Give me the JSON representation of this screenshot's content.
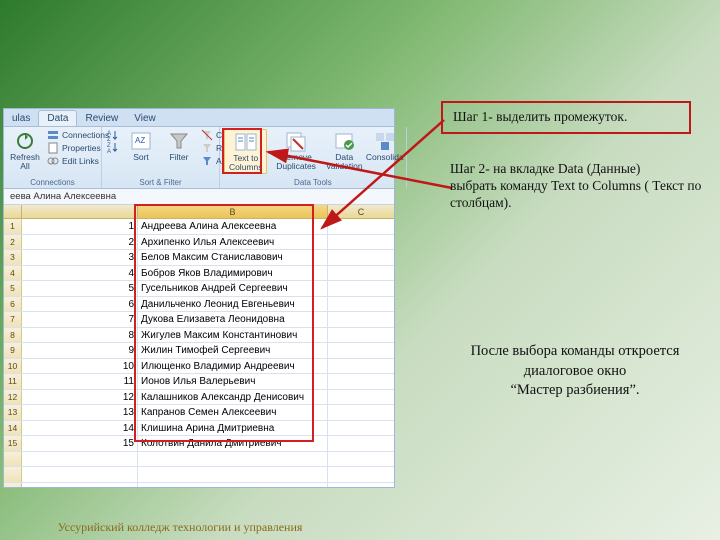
{
  "ribbon": {
    "tabs": [
      "ulas",
      "Data",
      "Review",
      "View"
    ],
    "active": 1,
    "groups": {
      "connections": {
        "label": "Connections",
        "refresh": "Refresh All",
        "items": [
          "Connections",
          "Properties",
          "Edit Links"
        ]
      },
      "sortfilter": {
        "label": "Sort & Filter",
        "sort": "Sort",
        "filter": "Filter",
        "items": [
          "Clear",
          "Reapply",
          "Advanced"
        ]
      },
      "datatools": {
        "label": "Data Tools",
        "t2c": "Text to Columns",
        "dup": "Remove Duplicates",
        "val": "Data Validation",
        "cons": "Consolida"
      }
    }
  },
  "formula_bar": "еева Алина Алексеевна",
  "col_headers": {
    "B": "B",
    "C": "C"
  },
  "rows": [
    {
      "n": "1",
      "v": "Андреева Алина Алексеевна"
    },
    {
      "n": "2",
      "v": "Архипенко Илья Алексеевич"
    },
    {
      "n": "3",
      "v": "Белов Максим Станиславович"
    },
    {
      "n": "4",
      "v": "Бобров Яков Владимирович"
    },
    {
      "n": "5",
      "v": "Гусельников Андрей Сергеевич"
    },
    {
      "n": "6",
      "v": "Данильченко Леонид Евгеньевич"
    },
    {
      "n": "7",
      "v": "Дукова Елизавета Леонидовна"
    },
    {
      "n": "8",
      "v": "Жигулев Максим Константинович"
    },
    {
      "n": "9",
      "v": "Жилин Тимофей Сергеевич"
    },
    {
      "n": "10",
      "v": "Илющенко Владимир Андреевич"
    },
    {
      "n": "11",
      "v": "Ионов Илья Валерьевич"
    },
    {
      "n": "12",
      "v": "Калашников Александр Денисович"
    },
    {
      "n": "13",
      "v": "Капранов Семен Алексеевич"
    },
    {
      "n": "14",
      "v": "Клишина Арина Дмитриевна"
    },
    {
      "n": "15",
      "v": "Колотвин Данила Дмитриевич"
    }
  ],
  "callout1": "Шаг 1- выделить промежуток.",
  "callout2": "Шаг 2- на вкладке Data (Данные)\nвыбрать  команду Text to Columns ( Текст по столбцам).",
  "bottom_note": "После выбора команды откроется\nдиалоговое окно\n“Мастер разбиения”.",
  "footer": "Уссурийский колледж технологии и управления"
}
